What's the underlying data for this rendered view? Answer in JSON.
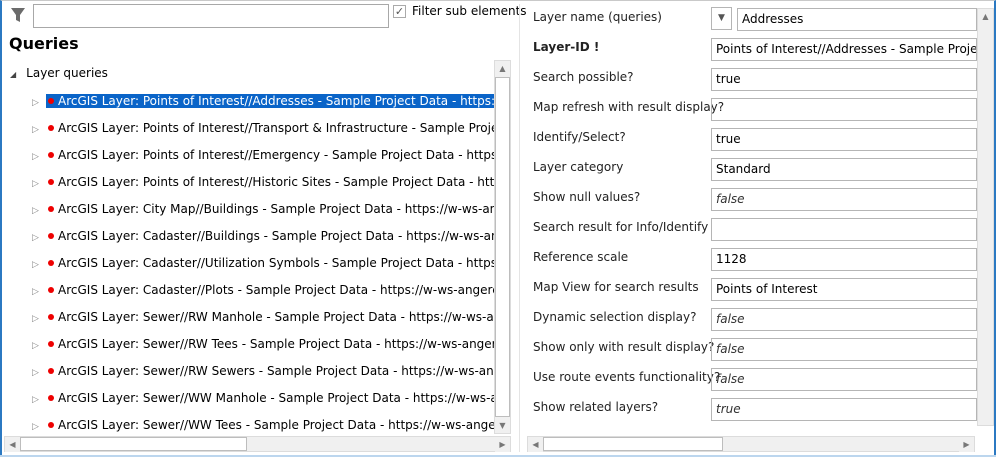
{
  "filter": {
    "value": "",
    "checkbox_label": "Filter sub elements",
    "checked": true
  },
  "title": "Queries",
  "tree": {
    "root": "Layer queries",
    "items": [
      "ArcGIS Layer: Points of Interest//Addresses - Sample Project Data - https://w-ws-anger",
      "ArcGIS Layer: Points of Interest//Transport & Infrastructure - Sample Project Data - http",
      "ArcGIS Layer: Points of Interest//Emergency - Sample Project Data - https://w-ws-anger",
      "ArcGIS Layer: Points of Interest//Historic Sites - Sample Project Data - https://w-ws-ang",
      "ArcGIS Layer: City Map//Buildings - Sample Project Data - https://w-ws-angerer.synerg",
      "ArcGIS Layer: Cadaster//Buildings - Sample Project Data - https://w-ws-angerer.synerg",
      "ArcGIS Layer: Cadaster//Utilization Symbols - Sample Project Data - https://w-ws-ange",
      "ArcGIS Layer: Cadaster//Plots - Sample Project Data - https://w-ws-angerer.synergis.in",
      "ArcGIS Layer: Sewer//RW Manhole - Sample Project Data - https://w-ws-angerer.syner",
      "ArcGIS Layer: Sewer//RW Tees - Sample Project Data - https://w-ws-angerer.synergis.in",
      "ArcGIS Layer: Sewer//RW Sewers - Sample Project Data - https://w-ws-angerer.synergi",
      "ArcGIS Layer: Sewer//WW Manhole - Sample Project Data - https://w-ws-angerer.syne",
      "ArcGIS Layer: Sewer//WW Tees - Sample Project Data - https://w-ws-angerer.synergis.i"
    ]
  },
  "properties": [
    {
      "label": "Layer name (queries)",
      "value": "Addresses"
    },
    {
      "label": "Layer-ID !",
      "value": "Points of Interest//Addresses - Sample Project Data"
    },
    {
      "label": "Search possible?",
      "value": "true"
    },
    {
      "label": "Map refresh with result display?",
      "value": ""
    },
    {
      "label": "Identify/Select?",
      "value": "true"
    },
    {
      "label": "Layer category",
      "value": "Standard"
    },
    {
      "label": "Show null values?",
      "value": "false"
    },
    {
      "label": "Search result for Info/Identify",
      "value": ""
    },
    {
      "label": "Reference scale",
      "value": "1128"
    },
    {
      "label": "Map View for search results",
      "value": "Points of Interest"
    },
    {
      "label": "Dynamic selection display?",
      "value": "false"
    },
    {
      "label": "Show only with result display?",
      "value": "false"
    },
    {
      "label": "Use route events functionality?",
      "value": "false"
    },
    {
      "label": "Show related layers?",
      "value": "true"
    }
  ]
}
